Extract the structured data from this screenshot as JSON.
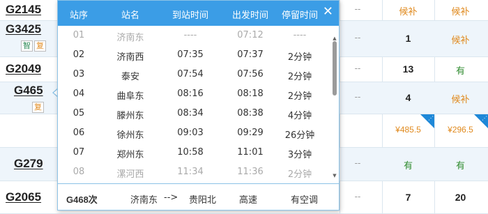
{
  "background_rows": [
    {
      "train": "G2145",
      "tags": [],
      "dash1": "--",
      "avail1": "候补",
      "avail2": "候补",
      "avail1_type": "hb",
      "avail2_type": "hb"
    },
    {
      "train": "G3425",
      "tags": [
        "智",
        "复"
      ],
      "dash1": "--",
      "avail1": "1",
      "avail2": "候补",
      "avail1_type": "num",
      "avail2_type": "hb"
    },
    {
      "train": "G2049",
      "tags": [],
      "dash1": "--",
      "avail1": "13",
      "avail2": "有",
      "avail1_type": "num",
      "avail2_type": "you"
    },
    {
      "train": "G465",
      "tags": [
        "复"
      ],
      "dash1": "--",
      "avail1": "4",
      "avail2": "候补",
      "avail1_type": "num",
      "avail2_type": "hb"
    },
    {
      "train": "",
      "tags": [],
      "dash1": "",
      "avail1": "¥485.5",
      "avail2": "¥296.5",
      "avail1_type": "price",
      "avail2_type": "price"
    },
    {
      "train": "G279",
      "tags": [],
      "dash1": "--",
      "avail1": "有",
      "avail2": "有",
      "avail1_type": "you",
      "avail2_type": "you"
    },
    {
      "train": "G2065",
      "tags": [],
      "dash1": "--",
      "avail1": "7",
      "avail2": "20",
      "avail1_type": "num",
      "avail2_type": "num"
    }
  ],
  "popup": {
    "headers": {
      "no": "站序",
      "station": "站名",
      "arrive": "到站时间",
      "depart": "出发时间",
      "stop": "停留时间"
    },
    "close": "✕",
    "stops": [
      {
        "no": "01",
        "station": "济南东",
        "arrive": "----",
        "depart": "07:12",
        "stop": "----",
        "muted": true
      },
      {
        "no": "02",
        "station": "济南西",
        "arrive": "07:35",
        "depart": "07:37",
        "stop": "2分钟",
        "muted": false
      },
      {
        "no": "03",
        "station": "泰安",
        "arrive": "07:54",
        "depart": "07:56",
        "stop": "2分钟",
        "muted": false
      },
      {
        "no": "04",
        "station": "曲阜东",
        "arrive": "08:16",
        "depart": "08:18",
        "stop": "2分钟",
        "muted": false
      },
      {
        "no": "05",
        "station": "滕州东",
        "arrive": "08:34",
        "depart": "08:38",
        "stop": "4分钟",
        "muted": false
      },
      {
        "no": "06",
        "station": "徐州东",
        "arrive": "09:03",
        "depart": "09:29",
        "stop": "26分钟",
        "muted": false
      },
      {
        "no": "07",
        "station": "郑州东",
        "arrive": "10:58",
        "depart": "11:01",
        "stop": "3分钟",
        "muted": false
      },
      {
        "no": "08",
        "station": "漯河西",
        "arrive": "11:34",
        "depart": "11:36",
        "stop": "2分钟",
        "muted": true
      }
    ],
    "footer": {
      "train": "G468次",
      "from": "济南东",
      "arrow": "-->",
      "to": "贵阳北",
      "type": "高速",
      "ac": "有空调"
    }
  },
  "colors": {
    "header_bg": "#3b9de6",
    "available": "#2e8b2e",
    "waitlist": "#e08a1e"
  }
}
